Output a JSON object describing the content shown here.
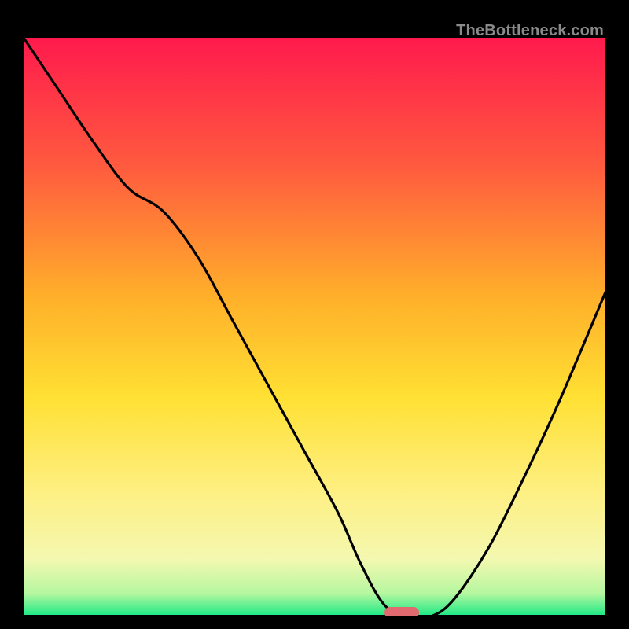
{
  "watermark": "TheBottleneck.com",
  "colors": {
    "top": "#ff1a4d",
    "red": "#ff2a4a",
    "orange": "#ff7a3a",
    "yellow": "#ffd21f",
    "ylight": "#ffee70",
    "pale": "#fdf7b8",
    "green": "#17e884",
    "marker": "#e06a6f",
    "curve": "#000000"
  },
  "chart_data": {
    "type": "line",
    "title": "",
    "xlabel": "",
    "ylabel": "",
    "xlim": [
      0,
      100
    ],
    "ylim": [
      0,
      100
    ],
    "gradient_stops": [
      {
        "pct": 0,
        "color": "#ff1a4d"
      },
      {
        "pct": 22,
        "color": "#ff5a3f"
      },
      {
        "pct": 45,
        "color": "#ffb02a"
      },
      {
        "pct": 62,
        "color": "#ffe033"
      },
      {
        "pct": 78,
        "color": "#feef80"
      },
      {
        "pct": 90,
        "color": "#f4f8b0"
      },
      {
        "pct": 96,
        "color": "#b6f7a0"
      },
      {
        "pct": 100,
        "color": "#17e884"
      }
    ],
    "series": [
      {
        "name": "bottleneck-curve",
        "x": [
          0,
          6,
          12,
          18,
          24,
          30,
          36,
          42,
          48,
          54,
          58,
          62,
          66,
          70,
          74,
          80,
          86,
          92,
          100
        ],
        "y": [
          100,
          91,
          82,
          74,
          70,
          62,
          51,
          40,
          29,
          18,
          9,
          2,
          0,
          0,
          3,
          12,
          24,
          37,
          56
        ]
      }
    ],
    "marker": {
      "x_start": 62,
      "x_end": 68,
      "y": 0,
      "label": ""
    }
  }
}
